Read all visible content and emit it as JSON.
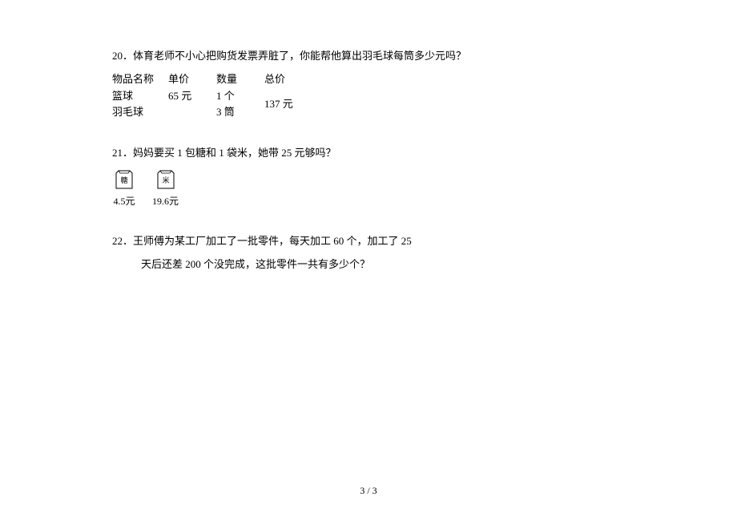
{
  "q20": {
    "number": "20．",
    "text": "体育老师不小心把购货发票弄脏了，你能帮他算出羽毛球每筒多少元吗？",
    "table": {
      "header": {
        "c1": "物品名称",
        "c2": "单价",
        "c3": "数量",
        "c4": "总价"
      },
      "row1": {
        "c1": "篮球",
        "c2": "65 元",
        "c3": "1 个"
      },
      "row2": {
        "c1": "羽毛球",
        "c2": "",
        "c3": "3 筒"
      },
      "total": "137 元"
    }
  },
  "q21": {
    "number": "21．",
    "text": "妈妈要买 1 包糖和 1 袋米，她带 25 元够吗？",
    "item1": {
      "label": "糖",
      "price": "4.5元"
    },
    "item2": {
      "label": "米",
      "price": "19.6元"
    }
  },
  "q22": {
    "number": "22．",
    "line1": "王师傅为某工厂加工了一批零件，每天加工 60 个，加工了 25",
    "line2": "天后还差 200 个没完成，这批零件一共有多少个？"
  },
  "footer": "3 / 3"
}
